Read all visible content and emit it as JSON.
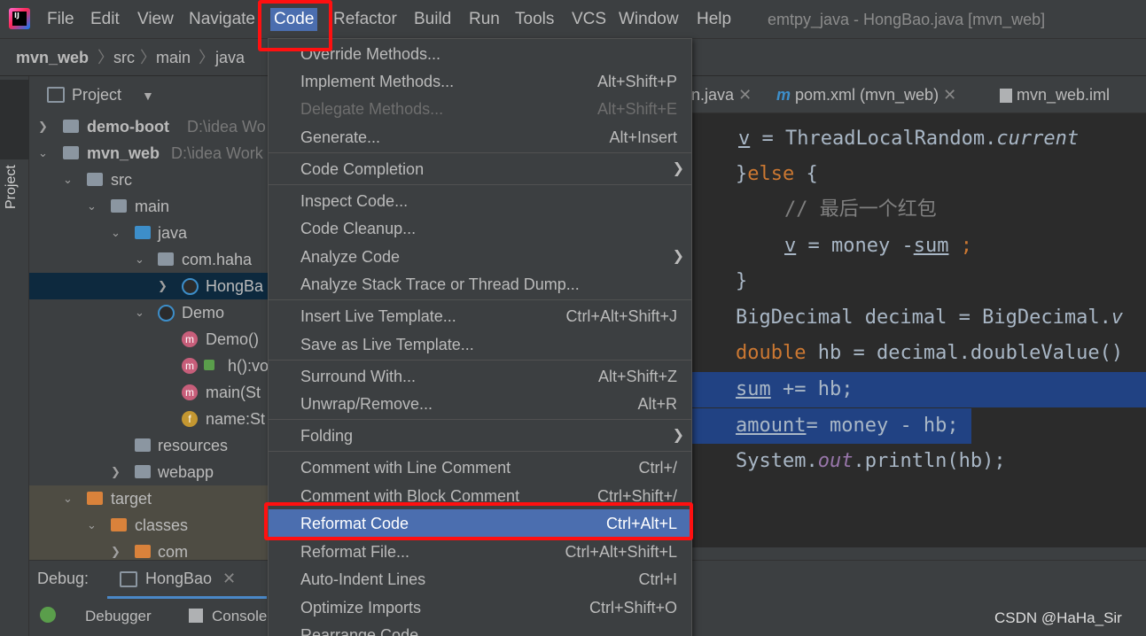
{
  "menubar": {
    "items": [
      "File",
      "Edit",
      "View",
      "Navigate",
      "Code",
      "Refactor",
      "Build",
      "Run",
      "Tools",
      "VCS",
      "Window",
      "Help"
    ],
    "window_title": "emtpy_java - HongBao.java [mvn_web]"
  },
  "breadcrumb": [
    "mvn_web",
    "src",
    "main",
    "java"
  ],
  "project_panel": {
    "title": "Project",
    "tree": [
      {
        "label": "demo-boot",
        "path": "D:\\idea Wo"
      },
      {
        "label": "mvn_web",
        "path": "D:\\idea Work"
      },
      {
        "label": "src"
      },
      {
        "label": "main"
      },
      {
        "label": "java"
      },
      {
        "label": "com.haha"
      },
      {
        "label": "HongBa"
      },
      {
        "label": "Demo"
      },
      {
        "label": "Demo()"
      },
      {
        "label": "h():vo"
      },
      {
        "label": "main(St"
      },
      {
        "label": "name:St"
      },
      {
        "label": "resources"
      },
      {
        "label": "webapp"
      },
      {
        "label": "target"
      },
      {
        "label": "classes"
      },
      {
        "label": "com"
      }
    ]
  },
  "editor_tabs": [
    "n.java",
    "pom.xml (mvn_web)",
    "mvn_web.iml"
  ],
  "editor": {
    "line1": {
      "a": "v",
      "b": " = ThreadLocalRandom.",
      "c": "current"
    },
    "line2": {
      "a": "}",
      "b": "else",
      "c": " {"
    },
    "line3": "// 最后一个红包",
    "line4": {
      "a": "v",
      "b": " = money -",
      "c": "sum",
      "d": " ;"
    },
    "line5": "}",
    "line6": {
      "a": "BigDecimal decimal = BigDecimal.",
      "b": "v"
    },
    "line7": {
      "a": "double",
      "b": " hb = decimal.doubleValue()"
    },
    "line8": {
      "a": "sum",
      "b": " += hb;"
    },
    "line9": {
      "a": "amount",
      "b": "= money - hb;"
    },
    "line10": {
      "a": "System.",
      "b": "out",
      "c": ".println(hb);"
    }
  },
  "debug": {
    "label": "Debug:",
    "tab": "HongBao",
    "debugger": "Debugger",
    "console": "Console"
  },
  "code_menu": {
    "items": [
      {
        "label": "Override Methods...",
        "shortcut": ""
      },
      {
        "label": "Implement Methods...",
        "shortcut": "Alt+Shift+P"
      },
      {
        "label": "Delegate Methods...",
        "shortcut": "Alt+Shift+E"
      },
      {
        "label": "Generate...",
        "shortcut": "Alt+Insert"
      },
      {
        "label": "Code Completion",
        "shortcut": ""
      },
      {
        "label": "Inspect Code...",
        "shortcut": ""
      },
      {
        "label": "Code Cleanup...",
        "shortcut": ""
      },
      {
        "label": "Analyze Code",
        "shortcut": ""
      },
      {
        "label": "Analyze Stack Trace or Thread Dump...",
        "shortcut": ""
      },
      {
        "label": "Insert Live Template...",
        "shortcut": "Ctrl+Alt+Shift+J"
      },
      {
        "label": "Save as Live Template...",
        "shortcut": ""
      },
      {
        "label": "Surround With...",
        "shortcut": "Alt+Shift+Z"
      },
      {
        "label": "Unwrap/Remove...",
        "shortcut": "Alt+R"
      },
      {
        "label": "Folding",
        "shortcut": ""
      },
      {
        "label": "Comment with Line Comment",
        "shortcut": "Ctrl+/"
      },
      {
        "label": "Comment with Block Comment",
        "shortcut": "Ctrl+Shift+/"
      },
      {
        "label": "Reformat Code",
        "shortcut": "Ctrl+Alt+L"
      },
      {
        "label": "Reformat File...",
        "shortcut": "Ctrl+Alt+Shift+L"
      },
      {
        "label": "Auto-Indent Lines",
        "shortcut": "Ctrl+I"
      },
      {
        "label": "Optimize Imports",
        "shortcut": "Ctrl+Shift+O"
      },
      {
        "label": "Rearrange Code",
        "shortcut": ""
      }
    ]
  },
  "watermark": "CSDN @HaHa_Sir",
  "colors": {
    "accent": "#4b6eaf",
    "highlight_box": "#ff1010",
    "selection": "#214283"
  }
}
